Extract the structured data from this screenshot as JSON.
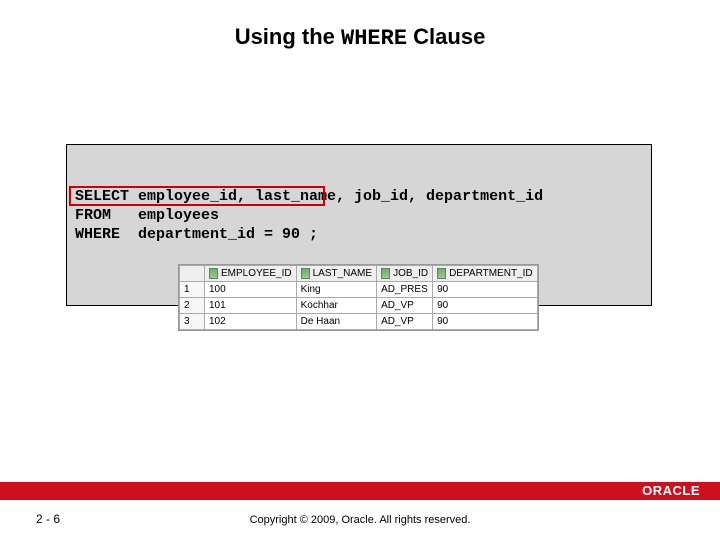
{
  "title": {
    "pre": "Using the ",
    "code": "WHERE",
    "post": " Clause"
  },
  "sql": {
    "line1": "SELECT employee_id, last_name, job_id, department_id",
    "line2": "FROM   employees",
    "line3": "WHERE  department_id = 90 ;"
  },
  "result": {
    "headers": {
      "c1": "EMPLOYEE_ID",
      "c2": "LAST_NAME",
      "c3": "JOB_ID",
      "c4": "DEPARTMENT_ID"
    },
    "rows": [
      {
        "n": "1",
        "c1": "100",
        "c2": "King",
        "c3": "AD_PRES",
        "c4": "90"
      },
      {
        "n": "2",
        "c1": "101",
        "c2": "Kochhar",
        "c3": "AD_VP",
        "c4": "90"
      },
      {
        "n": "3",
        "c1": "102",
        "c2": "De Haan",
        "c3": "AD_VP",
        "c4": "90"
      }
    ]
  },
  "footer": {
    "slide_number": "2 - 6",
    "copyright": "Copyright © 2009, Oracle. All rights reserved.",
    "logo": "ORACLE"
  }
}
